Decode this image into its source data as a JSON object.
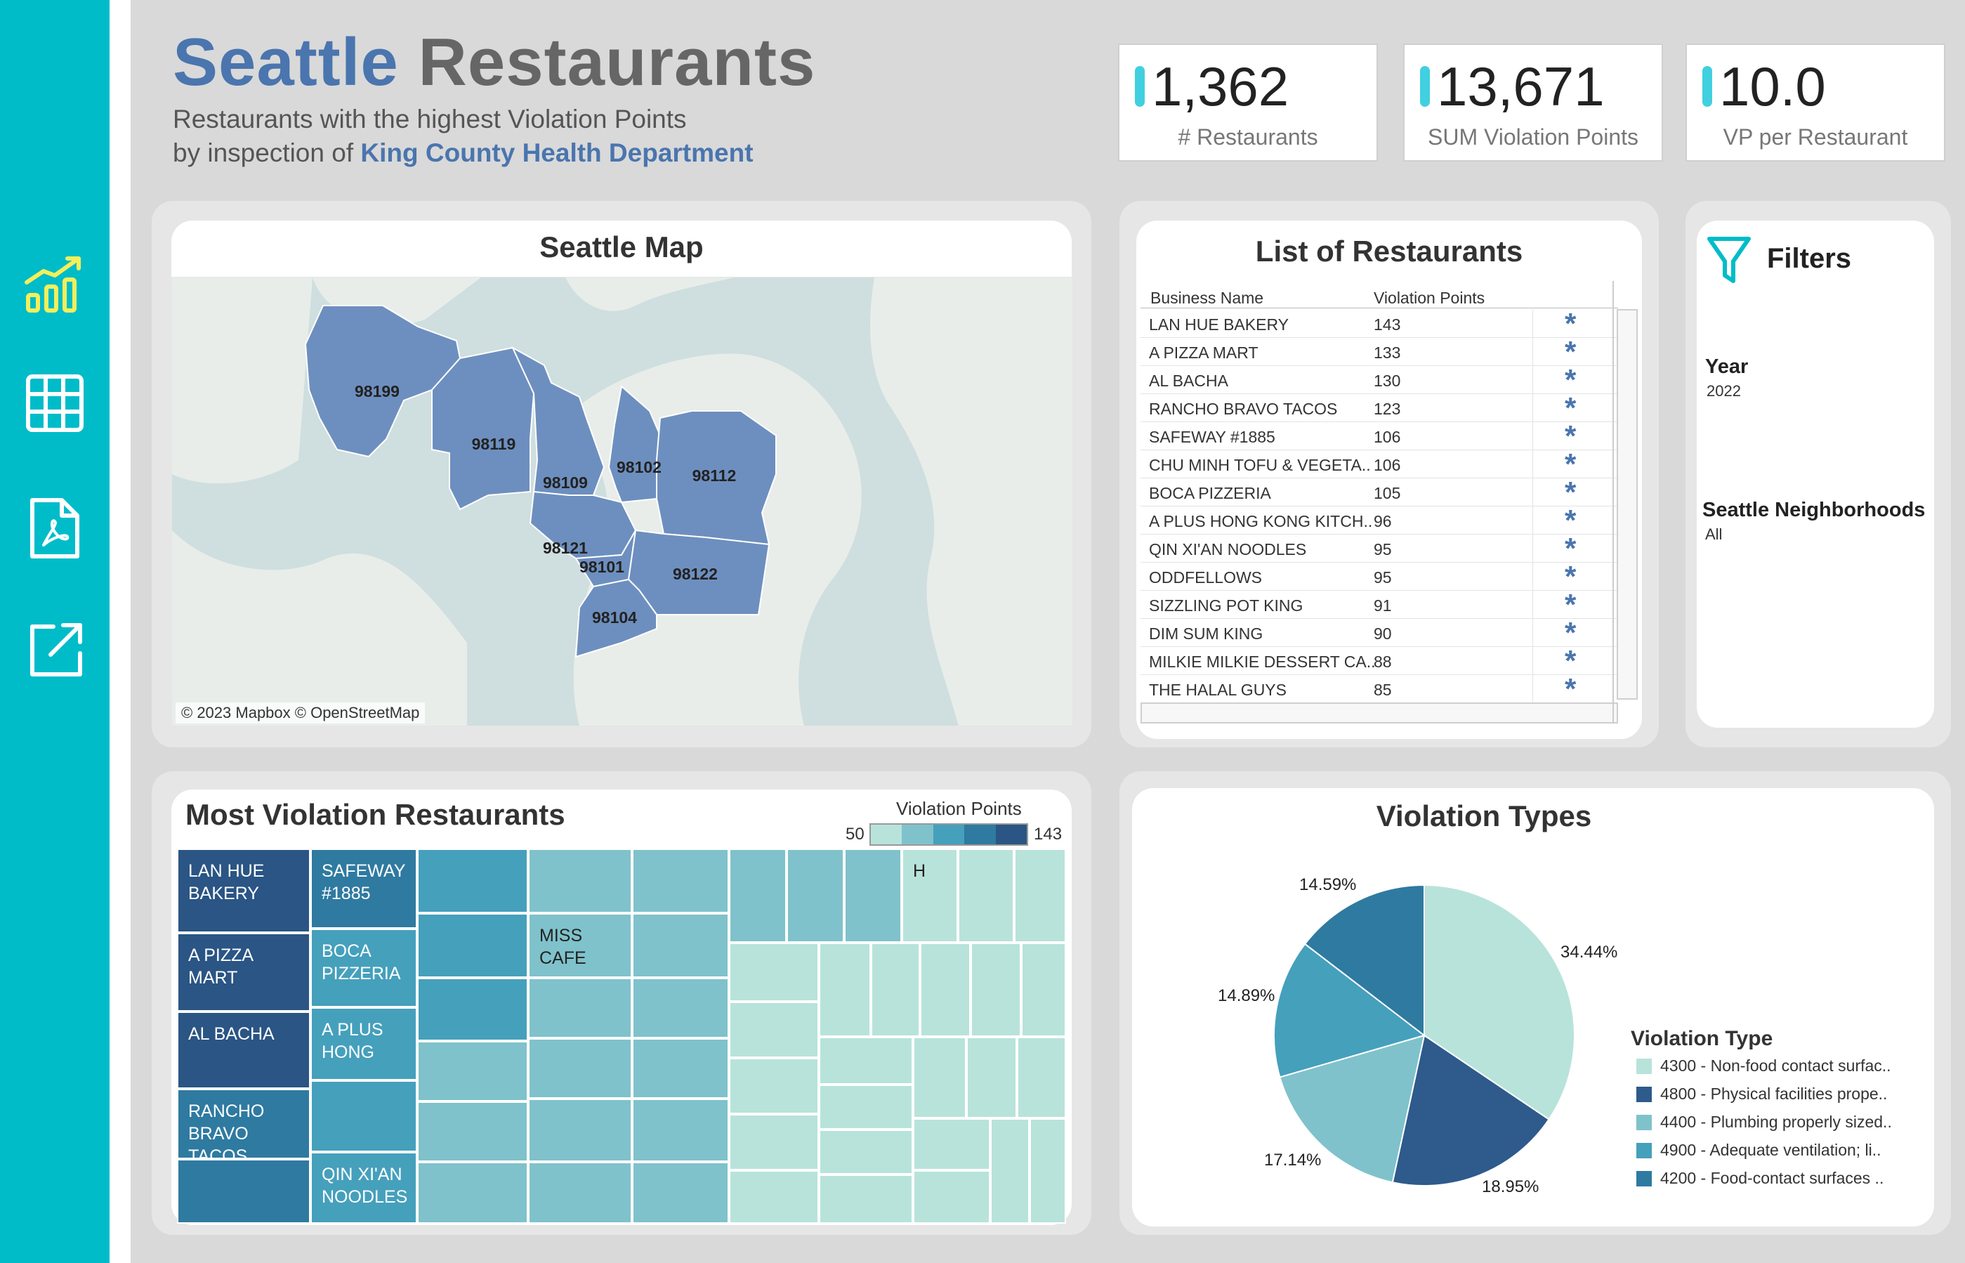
{
  "sidebar": {
    "icons": [
      "chart-growth-icon",
      "table-grid-icon",
      "pdf-file-icon",
      "external-link-icon"
    ]
  },
  "header": {
    "title_part1": "Seattle",
    "title_part2": "Restaurants",
    "subtitle_line1": "Restaurants with the highest Violation Points",
    "subtitle_line2_prefix": "by inspection of",
    "subtitle_line2_highlight": "King County Health Department"
  },
  "kpis": [
    {
      "value": "1,362",
      "label": "# Restaurants"
    },
    {
      "value": "13,671",
      "label": "SUM Violation Points"
    },
    {
      "value": "10.0",
      "label": "VP per Restaurant"
    }
  ],
  "map": {
    "title": "Seattle Map",
    "credit": "© 2023 Mapbox © OpenStreetMap",
    "zip_labels": [
      "98199",
      "98119",
      "98109",
      "98102",
      "98112",
      "98121",
      "98101",
      "98122",
      "98104"
    ]
  },
  "list": {
    "title": "List of Restaurants",
    "col_name": "Business Name",
    "col_points": "Violation Points",
    "rows": [
      {
        "name": "LAN HUE BAKERY",
        "points": "143"
      },
      {
        "name": "A PIZZA MART",
        "points": "133"
      },
      {
        "name": "AL BACHA",
        "points": "130"
      },
      {
        "name": "RANCHO BRAVO TACOS",
        "points": "123"
      },
      {
        "name": "SAFEWAY #1885",
        "points": "106"
      },
      {
        "name": "CHU MINH TOFU & VEGETA..",
        "points": "106"
      },
      {
        "name": "BOCA PIZZERIA",
        "points": "105"
      },
      {
        "name": "A PLUS HONG KONG KITCH..",
        "points": "96"
      },
      {
        "name": "QIN XI'AN NOODLES",
        "points": "95"
      },
      {
        "name": "ODDFELLOWS",
        "points": "95"
      },
      {
        "name": "SIZZLING POT KING",
        "points": "91"
      },
      {
        "name": "DIM SUM KING",
        "points": "90"
      },
      {
        "name": "MILKIE MILKIE DESSERT CA..",
        "points": "88"
      },
      {
        "name": "THE HALAL GUYS",
        "points": "85"
      }
    ]
  },
  "filters": {
    "title": "Filters",
    "year_label": "Year",
    "year_value": "2022",
    "neighborhood_label": "Seattle Neighborhoods",
    "neighborhood_value": "All"
  },
  "treemap": {
    "title": "Most Violation Restaurants",
    "legend_title": "Violation Points",
    "legend_min": "50",
    "legend_max": "143",
    "labels": {
      "lan_hue": "LAN HUE BAKERY",
      "a_pizza": "A PIZZA MART",
      "al_bacha": "AL BACHA",
      "rancho": "RANCHO BRAVO TACOS",
      "safeway": "SAFEWAY #1885",
      "boca": "BOCA PIZZERIA",
      "a_plus": "A PLUS HONG",
      "qin": "QIN XI'AN NOODLES",
      "miss_cafe": "MISS CAFE",
      "h": "H"
    }
  },
  "chart_data": {
    "type": "pie",
    "title": "Violation Types",
    "legend_title": "Violation Type",
    "slices": [
      {
        "label": "4300 - Non-food contact surfac..",
        "value": 34.44,
        "display": "34.44%",
        "color": "#b8e3da"
      },
      {
        "label": "4800 - Physical facilities prope..",
        "value": 18.95,
        "display": "18.95%",
        "color": "#2e5a8c"
      },
      {
        "label": "4400 - Plumbing properly sized..",
        "value": 17.14,
        "display": "17.14%",
        "color": "#7fc2cb"
      },
      {
        "label": "4900 - Adequate ventilation; li..",
        "value": 14.89,
        "display": "14.89%",
        "color": "#45a0bc"
      },
      {
        "label": "4200 - Food-contact surfaces ..",
        "value": 14.59,
        "display": "14.59%",
        "color": "#2f7aa0"
      }
    ]
  },
  "colors": {
    "accent": "#00bcc9",
    "title_blue": "#4a75ae",
    "map_fill": "#6d8fbf"
  }
}
